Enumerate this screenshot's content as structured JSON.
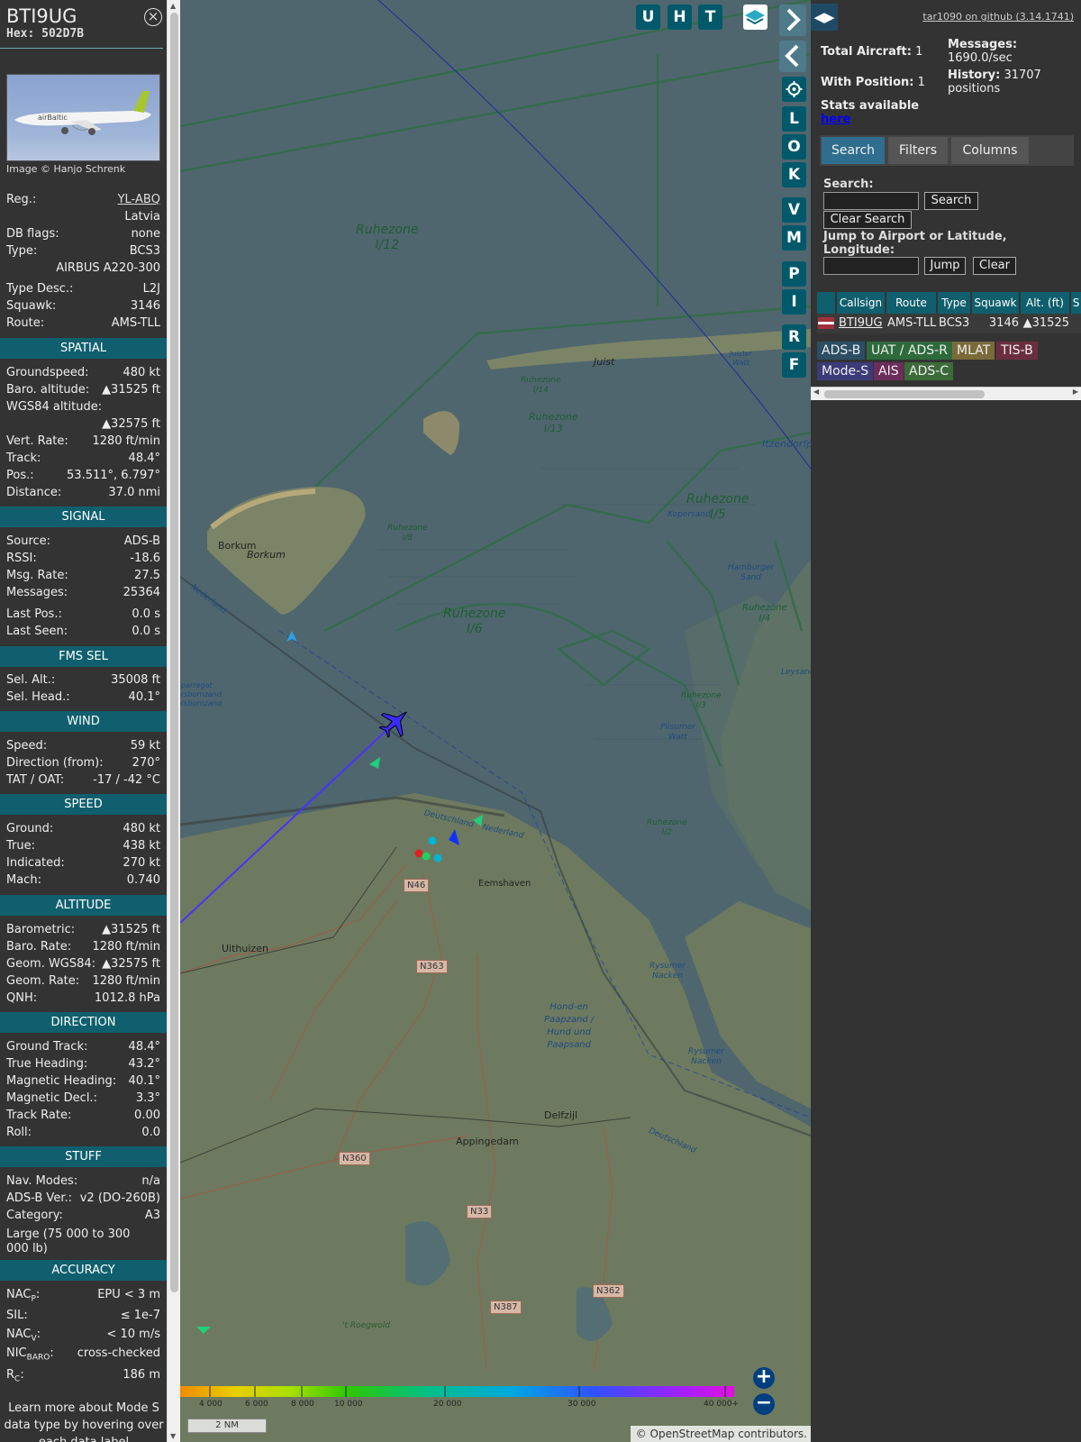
{
  "aircraft": {
    "callsign": "BTI9UG",
    "hex": "Hex: 502D7B",
    "photo_credit": "Image © Hanjo Schrenk"
  },
  "info": {
    "reg_label": "Reg.:",
    "reg_value": "YL-ABQ",
    "country": "Latvia",
    "dbflags_label": "DB flags:",
    "dbflags_value": "none",
    "type_label": "Type:",
    "type_value": "BCS3",
    "type_name": "AIRBUS A220-300",
    "typedesc_label": "Type Desc.:",
    "typedesc_value": "L2J",
    "squawk_label": "Squawk:",
    "squawk_value": "3146",
    "route_label": "Route:",
    "route_value": "AMS-TLL"
  },
  "sections": {
    "spatial": "SPATIAL",
    "signal": "SIGNAL",
    "fms": "FMS SEL",
    "wind": "WIND",
    "speed": "SPEED",
    "altitude": "ALTITUDE",
    "direction": "DIRECTION",
    "stuff": "STUFF",
    "accuracy": "ACCURACY"
  },
  "spatial": {
    "gs_label": "Groundspeed:",
    "gs_value": "480 kt",
    "baro_label": "Baro. altitude:",
    "baro_value": "▲31525 ft",
    "wgs_label": "WGS84 altitude:",
    "wgs_value": "▲32575 ft",
    "vr_label": "Vert. Rate:",
    "vr_value": "1280 ft/min",
    "track_label": "Track:",
    "track_value": "48.4°",
    "pos_label": "Pos.:",
    "pos_value": "53.511°, 6.797°",
    "dist_label": "Distance:",
    "dist_value": "37.0 nmi"
  },
  "signal": {
    "source_label": "Source:",
    "source_value": "ADS-B",
    "rssi_label": "RSSI:",
    "rssi_value": "-18.6",
    "rate_label": "Msg. Rate:",
    "rate_value": "27.5",
    "msgs_label": "Messages:",
    "msgs_value": "25364",
    "lastpos_label": "Last Pos.:",
    "lastpos_value": "0.0 s",
    "lastseen_label": "Last Seen:",
    "lastseen_value": "0.0 s"
  },
  "fms": {
    "alt_label": "Sel. Alt.:",
    "alt_value": "35008 ft",
    "head_label": "Sel. Head.:",
    "head_value": "40.1°"
  },
  "wind": {
    "speed_label": "Speed:",
    "speed_value": "59 kt",
    "dir_label": "Direction (from):",
    "dir_value": "270°",
    "tat_label": "TAT / OAT:",
    "tat_value": "-17 / -42 °C"
  },
  "speed": {
    "ground_label": "Ground:",
    "ground_value": "480 kt",
    "true_label": "True:",
    "true_value": "438 kt",
    "ind_label": "Indicated:",
    "ind_value": "270 kt",
    "mach_label": "Mach:",
    "mach_value": "0.740"
  },
  "altitude": {
    "baro_label": "Barometric:",
    "baro_value": "▲31525 ft",
    "brate_label": "Baro. Rate:",
    "brate_value": "1280 ft/min",
    "geom_label": "Geom. WGS84:",
    "geom_value": "▲32575 ft",
    "grate_label": "Geom. Rate:",
    "grate_value": "1280 ft/min",
    "qnh_label": "QNH:",
    "qnh_value": "1012.8 hPa"
  },
  "direction": {
    "gt_label": "Ground Track:",
    "gt_value": "48.4°",
    "th_label": "True Heading:",
    "th_value": "43.2°",
    "mh_label": "Magnetic Heading:",
    "mh_value": "40.1°",
    "md_label": "Magnetic Decl.:",
    "md_value": "3.3°",
    "tr_label": "Track Rate:",
    "tr_value": "0.00",
    "roll_label": "Roll:",
    "roll_value": "0.0"
  },
  "stuff": {
    "nav_label": "Nav. Modes:",
    "nav_value": "n/a",
    "adsb_label": "ADS-B Ver.:",
    "adsb_value": "v2 (DO-260B)",
    "cat_label": "Category:",
    "cat_value": "A3",
    "cat_desc": "Large (75 000 to 300 000 lb)"
  },
  "accuracy": {
    "nacp_label": "NACP:",
    "nacp_value": "EPU < 3 m",
    "sil_label": "SIL:",
    "sil_value": "≤ 1e-7",
    "nacv_label": "NACV:",
    "nacv_value": "< 10 m/s",
    "nic_label": "NICBARO:",
    "nic_value": "cross-checked",
    "rc_label": "RC:",
    "rc_value": "186 m"
  },
  "footnote": "Learn more about Mode S data type by hovering over each data label",
  "map": {
    "buttons_top": [
      "U",
      "H",
      "T"
    ],
    "buttons_side": [
      "L",
      "O",
      "K",
      "V",
      "M",
      "P",
      "I",
      "R",
      "F"
    ],
    "scale": "2 NM",
    "attribution": "© OpenStreetMap contributors.",
    "alt_ticks": [
      "4 000",
      "6 000",
      "8 000",
      "10 000",
      "20 000",
      "30 000",
      "40 000+"
    ],
    "labels": {
      "ruhe12": "Ruhezone\nI/12",
      "ruhe6": "Ruhezone\nI/6",
      "ruhe5": "Ruhezone\nI/5",
      "ruhe14": "Ruhezone\nI/14",
      "ruhe13": "Ruhezone\nI/13",
      "ruhe8": "Ruhezone\nI/8",
      "ruhe4": "Ruhezone\nI/4",
      "ruhe3": "Ruhezone\nI/3",
      "ruhe2": "Ruhezone\nI/2",
      "hond": "Hond-en\nPaapzand /\nHund und\nPaapsand",
      "juist": "Juist",
      "borkum1": "Borkum",
      "borkum2": "Borkum",
      "eemshaven": "Eemshaven",
      "uithuizen": "Uithuizen",
      "delfzijl": "Delfzijl",
      "appingedam": "Appingedam",
      "kopersand": "Kopersand",
      "hamburger": "Hamburger\nSand",
      "pilsumer": "Pilsumer\nWatt",
      "rysumer1": "Rysumer\nNacken",
      "rysumer2": "Rysumer\nNacken",
      "leysand": "Leysand",
      "itzendorf": "Itzendorfp",
      "juister": "Juister\nWatt",
      "sparregat": "Sparregat\norsbornzand\norsbornzand",
      "nederland1": "Nederland",
      "nederland2": "Nederland",
      "deutschland1": "Deutschland",
      "deutschland2": "Deutschland",
      "roegwold": "'t Roegwold"
    },
    "roads": [
      "N46",
      "N363",
      "N360",
      "N33",
      "N387",
      "N362"
    ]
  },
  "sidebar": {
    "github": "tar1090 on github (3.14.1741)",
    "total_label": "Total Aircraft:",
    "total_value": "1",
    "withpos_label": "With Position:",
    "withpos_value": "1",
    "messages_label": "Messages:",
    "messages_value": "1690.0/sec",
    "history_label": "History:",
    "history_value": "31707 positions",
    "stats_label": "Stats available",
    "stats_link": "here",
    "tabs": [
      "Search",
      "Filters",
      "Columns"
    ],
    "search_label": "Search:",
    "search_button": "Search",
    "clear_search_button": "Clear Search",
    "jump_label": "Jump to Airport or Latitude, Longitude:",
    "jump_button": "Jump",
    "clear_button": "Clear",
    "columns": [
      "Callsign",
      "Route",
      "Type",
      "Squawk",
      "Alt. (ft)",
      "S"
    ],
    "row": {
      "callsign": "BTI9UG",
      "route": "AMS-TLL",
      "type": "BCS3",
      "squawk": "3146",
      "alt": "▲31525"
    },
    "tags": [
      "ADS-B",
      "UAT / ADS-R",
      "MLAT",
      "TIS-B",
      "Mode-S",
      "AIS",
      "ADS-C"
    ]
  },
  "colors": {
    "section_bg": "#0f5f6e",
    "tag_adsb": "#2b4e63",
    "tag_uat": "#2e6b3c",
    "tag_mlat": "#7a6a3a",
    "tag_tisb": "#6b2e3e",
    "tag_modes": "#3b3b7a",
    "tag_ais": "#6b2e5b",
    "tag_adsc": "#3c6b3a"
  }
}
